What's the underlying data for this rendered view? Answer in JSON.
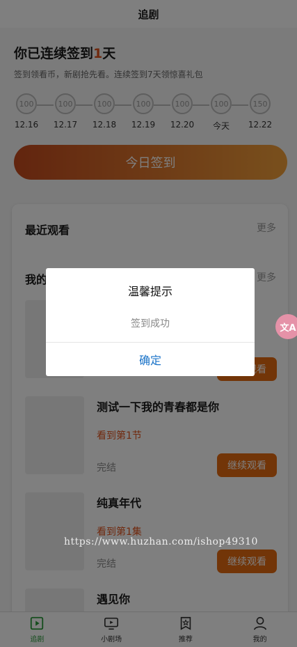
{
  "header": {
    "title": "追剧"
  },
  "checkin": {
    "title_prefix": "你已连续签到",
    "streak": "1",
    "title_suffix": "天",
    "subtitle": "签到领看币，新剧抢先看。连续签到7天领惊喜礼包",
    "days": [
      {
        "coins": "100",
        "label": "12.16"
      },
      {
        "coins": "100",
        "label": "12.17"
      },
      {
        "coins": "100",
        "label": "12.18"
      },
      {
        "coins": "100",
        "label": "12.19"
      },
      {
        "coins": "100",
        "label": "12.20"
      },
      {
        "coins": "100",
        "label": "今天"
      },
      {
        "coins": "150",
        "label": "12.22"
      }
    ],
    "button_label": "今日签到"
  },
  "recent": {
    "title": "最近观看",
    "more": "更多"
  },
  "mine": {
    "title": "我的",
    "more": "更多"
  },
  "dramas": [
    {
      "title": "",
      "progress": "",
      "status": "",
      "button": "继续观看"
    },
    {
      "title": "测试一下我的青春都是你",
      "progress": "看到第1节",
      "status": "完结",
      "button": "继续观看"
    },
    {
      "title": "纯真年代",
      "progress": "看到第1集",
      "status": "完结",
      "button": "继续观看"
    },
    {
      "title": "遇见你",
      "progress": "",
      "status": "",
      "button": ""
    }
  ],
  "tabs": [
    {
      "label": "追剧",
      "icon": "play-square-icon",
      "active": true
    },
    {
      "label": "小剧场",
      "icon": "tv-icon",
      "active": false
    },
    {
      "label": "推荐",
      "icon": "star-badge-icon",
      "active": false
    },
    {
      "label": "我的",
      "icon": "user-icon",
      "active": false
    }
  ],
  "dialog": {
    "title": "温馨提示",
    "message": "签到成功",
    "confirm": "确定"
  },
  "float_button": {
    "icon": "translate-icon",
    "text": "文A"
  },
  "watermark": "https://www.huzhan.com/ishop49310",
  "colors": {
    "accent": "#e0531d",
    "tab_active": "#2a9b3a",
    "link": "#1a73c8"
  }
}
